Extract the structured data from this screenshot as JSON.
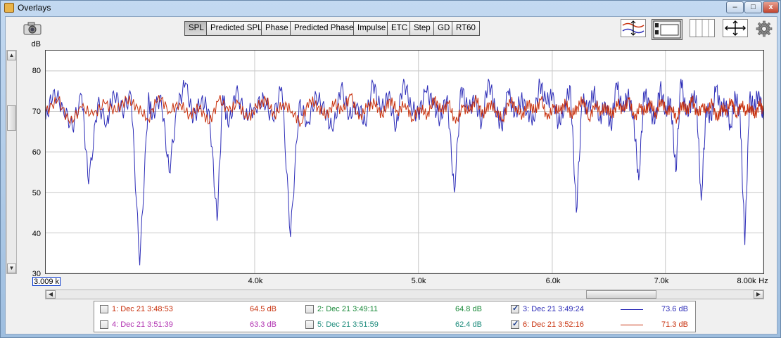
{
  "window": {
    "title": "Overlays",
    "buttons": {
      "minimize": "–",
      "maximize": "□",
      "close": "x"
    }
  },
  "toolbar": {
    "tabs": [
      {
        "label": "SPL",
        "active": true
      },
      {
        "label": "Predicted SPL",
        "active": false
      },
      {
        "label": "Phase",
        "active": false
      },
      {
        "label": "Predicted Phase",
        "active": false
      },
      {
        "label": "Impulse",
        "active": false
      },
      {
        "label": "ETC",
        "active": false
      },
      {
        "label": "Step",
        "active": false
      },
      {
        "label": "GD",
        "active": false
      },
      {
        "label": "RT60",
        "active": false
      }
    ],
    "icons": [
      "camera-icon",
      "align-traces-icon",
      "display-layout-icon",
      "columns-icon",
      "fit-axes-icon",
      "settings-gear-icon"
    ]
  },
  "chart": {
    "y_unit": "dB",
    "x_unit": "Hz",
    "cursor_readout": "3.009 k",
    "y_tick_labels": [
      "80",
      "70",
      "60",
      "50",
      "40",
      "30"
    ],
    "x_tick_labels": [
      "4.0k",
      "5.0k",
      "6.0k",
      "7.0k",
      "8.00k"
    ]
  },
  "chart_data": {
    "type": "line",
    "xlim": [
      3009,
      8000
    ],
    "ylim": [
      30,
      85
    ],
    "ylabel": "dB",
    "xlabel": "Hz",
    "yticks": [
      30,
      40,
      50,
      60,
      70,
      80
    ],
    "xticks": [
      4000,
      5000,
      6000,
      7000,
      8000
    ],
    "grid": true,
    "series": [
      {
        "name": "3: Dec 21 3:49:24",
        "color": "#2e2eb8",
        "x": [
          3009,
          3040,
          3080,
          3120,
          3160,
          3190,
          3230,
          3270,
          3300,
          3340,
          3380,
          3420,
          3460,
          3480,
          3520,
          3560,
          3600,
          3640,
          3680,
          3720,
          3760,
          3800,
          3830,
          3860,
          3900,
          3950,
          4000,
          4050,
          4100,
          4150,
          4200,
          4250,
          4300,
          4350,
          4400,
          4450,
          4500,
          4550,
          4600,
          4650,
          4700,
          4750,
          4800,
          4850,
          4900,
          4950,
          5000,
          5050,
          5100,
          5150,
          5200,
          5250,
          5300,
          5350,
          5400,
          5450,
          5500,
          5550,
          5600,
          5650,
          5700,
          5750,
          5800,
          5850,
          5900,
          5950,
          6000,
          6050,
          6100,
          6150,
          6200,
          6250,
          6300,
          6350,
          6400,
          6450,
          6500,
          6550,
          6600,
          6650,
          6700,
          6750,
          6800,
          6850,
          6900,
          6950,
          7000,
          7050,
          7100,
          7150,
          7200,
          7250,
          7300,
          7350,
          7400,
          7450,
          7500,
          7550,
          7600,
          7650,
          7700,
          7750,
          7800,
          7850,
          7900,
          7950,
          8000
        ],
        "values": [
          68,
          75,
          71,
          66,
          74,
          52,
          72,
          67,
          75,
          70,
          74,
          32,
          73,
          69,
          74,
          55,
          71,
          77,
          68,
          73,
          70,
          43,
          74,
          66,
          75,
          69,
          71,
          73,
          68,
          76,
          39,
          72,
          67,
          74,
          70,
          65,
          76,
          69,
          72,
          67,
          77,
          70,
          74,
          66,
          78,
          71,
          69,
          75,
          72,
          68,
          74,
          50,
          76,
          70,
          73,
          67,
          78,
          71,
          66,
          75,
          69,
          73,
          70,
          68,
          77,
          72,
          74,
          67,
          71,
          76,
          45,
          73,
          70,
          75,
          68,
          72,
          66,
          77,
          70,
          74,
          69,
          53,
          75,
          71,
          67,
          76,
          70,
          73,
          55,
          78,
          69,
          72,
          74,
          48,
          71,
          68,
          76,
          70,
          72,
          66,
          74,
          69,
          37,
          73,
          71,
          75,
          68
        ]
      },
      {
        "name": "6: Dec 21 3:52:16",
        "color": "#c8300c",
        "x": [
          3009,
          3060,
          3110,
          3160,
          3210,
          3260,
          3310,
          3360,
          3410,
          3460,
          3510,
          3560,
          3610,
          3660,
          3710,
          3760,
          3810,
          3860,
          3910,
          3960,
          4010,
          4060,
          4110,
          4160,
          4210,
          4260,
          4310,
          4360,
          4410,
          4460,
          4510,
          4560,
          4610,
          4660,
          4710,
          4760,
          4810,
          4860,
          4910,
          4960,
          5010,
          5060,
          5110,
          5160,
          5210,
          5260,
          5310,
          5360,
          5410,
          5460,
          5510,
          5560,
          5610,
          5660,
          5710,
          5760,
          5810,
          5860,
          5910,
          5960,
          6010,
          6060,
          6110,
          6160,
          6210,
          6260,
          6310,
          6360,
          6410,
          6460,
          6510,
          6560,
          6610,
          6660,
          6710,
          6760,
          6810,
          6860,
          6910,
          6960,
          7010,
          7060,
          7110,
          7160,
          7210,
          7260,
          7310,
          7360,
          7410,
          7460,
          7510,
          7560,
          7610,
          7660,
          7710,
          7760,
          7810,
          7860,
          7910,
          7960,
          8000
        ],
        "values": [
          70,
          73,
          67,
          71,
          69,
          72,
          70,
          73,
          71,
          68,
          74,
          70,
          72,
          69,
          71,
          67,
          73,
          70,
          72,
          68,
          71,
          73,
          69,
          72,
          70,
          67,
          73,
          71,
          69,
          72,
          70,
          74,
          68,
          71,
          72,
          69,
          73,
          70,
          72,
          68,
          71,
          69,
          73,
          70,
          72,
          67,
          71,
          70,
          73,
          69,
          72,
          70,
          68,
          73,
          71,
          69,
          72,
          70,
          73,
          68,
          71,
          70,
          72,
          69,
          71,
          73,
          68,
          72,
          70,
          71,
          69,
          72,
          70,
          73,
          68,
          71,
          70,
          72,
          69,
          73,
          70,
          71,
          68,
          72,
          70,
          73,
          69,
          71,
          70,
          72,
          68,
          71,
          70,
          73,
          69,
          72,
          70,
          71,
          69,
          72,
          70
        ]
      }
    ]
  },
  "legend": {
    "items": [
      {
        "label": "1: Dec 21 3:48:53",
        "value": "64.5 dB",
        "checked": false,
        "color": "#c8300c"
      },
      {
        "label": "2: Dec 21 3:49:11",
        "value": "64.8 dB",
        "checked": false,
        "color": "#1a8a3a"
      },
      {
        "label": "3: Dec 21 3:49:24",
        "value": "73.6 dB",
        "checked": true,
        "color": "#2e2eb8"
      },
      {
        "label": "4: Dec 21 3:51:39",
        "value": "63.3 dB",
        "checked": false,
        "color": "#b030b0"
      },
      {
        "label": "5: Dec 21 3:51:59",
        "value": "62.4 dB",
        "checked": false,
        "color": "#1a8a7a"
      },
      {
        "label": "6: Dec 21 3:52:16",
        "value": "71.3 dB",
        "checked": true,
        "color": "#c8300c"
      }
    ]
  }
}
